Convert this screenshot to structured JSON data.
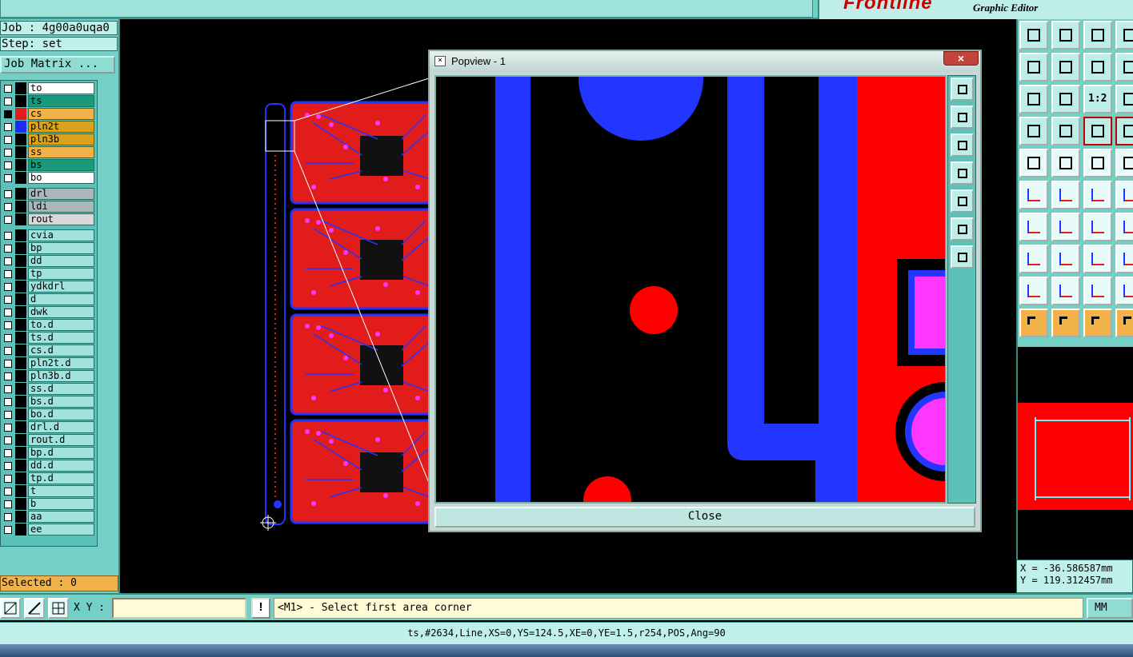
{
  "header": {
    "title_text": "",
    "brand": "Frontline",
    "brand_subtitle": "Graphic Editor"
  },
  "job": {
    "job_label": "Job : 4g00a0uqa0",
    "step_label": "Step: set",
    "matrix_button": "Job Matrix ..."
  },
  "layers": [
    {
      "name": "to",
      "color": "#ffffff",
      "swatch": "#000000",
      "checked": false
    },
    {
      "name": "ts",
      "color": "#1a9a7a",
      "swatch": "#000000",
      "checked": false
    },
    {
      "name": "cs",
      "color": "#f2b24a",
      "swatch": "#e21b1b",
      "checked": true
    },
    {
      "name": "pln2t",
      "color": "#d9a21a",
      "swatch": "#1d2bff",
      "checked": false
    },
    {
      "name": "pln3b",
      "color": "#d9a21a",
      "swatch": "#000000",
      "checked": false
    },
    {
      "name": "ss",
      "color": "#f2b24a",
      "swatch": "#000000",
      "checked": false
    },
    {
      "name": "bs",
      "color": "#1a9a7a",
      "swatch": "#000000",
      "checked": false
    },
    {
      "name": "bo",
      "color": "#ffffff",
      "swatch": "#000000",
      "checked": false
    },
    {
      "name": "drl",
      "color": "#a8b8b8",
      "swatch": "#000000",
      "checked": false
    },
    {
      "name": "ldi",
      "color": "#a8b8b8",
      "swatch": "#000000",
      "checked": false
    },
    {
      "name": "rout",
      "color": "#d8d8d8",
      "swatch": "#000000",
      "checked": false
    },
    {
      "name": "cvia",
      "color": "#9fe3dc",
      "swatch": "#000000",
      "checked": false
    },
    {
      "name": "bp",
      "color": "#9fe3dc",
      "swatch": "#000000",
      "checked": false
    },
    {
      "name": "dd",
      "color": "#9fe3dc",
      "swatch": "#000000",
      "checked": false
    },
    {
      "name": "tp",
      "color": "#9fe3dc",
      "swatch": "#000000",
      "checked": false
    },
    {
      "name": "ydkdrl",
      "color": "#9fe3dc",
      "swatch": "#000000",
      "checked": false
    },
    {
      "name": "d",
      "color": "#9fe3dc",
      "swatch": "#000000",
      "checked": false
    },
    {
      "name": "dwk",
      "color": "#9fe3dc",
      "swatch": "#000000",
      "checked": false
    },
    {
      "name": "to.d",
      "color": "#9fe3dc",
      "swatch": "#000000",
      "checked": false
    },
    {
      "name": "ts.d",
      "color": "#9fe3dc",
      "swatch": "#000000",
      "checked": false
    },
    {
      "name": "cs.d",
      "color": "#9fe3dc",
      "swatch": "#000000",
      "checked": false
    },
    {
      "name": "pln2t.d",
      "color": "#9fe3dc",
      "swatch": "#000000",
      "checked": false
    },
    {
      "name": "pln3b.d",
      "color": "#9fe3dc",
      "swatch": "#000000",
      "checked": false
    },
    {
      "name": "ss.d",
      "color": "#9fe3dc",
      "swatch": "#000000",
      "checked": false
    },
    {
      "name": "bs.d",
      "color": "#9fe3dc",
      "swatch": "#000000",
      "checked": false
    },
    {
      "name": "bo.d",
      "color": "#9fe3dc",
      "swatch": "#000000",
      "checked": false
    },
    {
      "name": "drl.d",
      "color": "#9fe3dc",
      "swatch": "#000000",
      "checked": false
    },
    {
      "name": "rout.d",
      "color": "#9fe3dc",
      "swatch": "#000000",
      "checked": false
    },
    {
      "name": "bp.d",
      "color": "#9fe3dc",
      "swatch": "#000000",
      "checked": false
    },
    {
      "name": "dd.d",
      "color": "#9fe3dc",
      "swatch": "#000000",
      "checked": false
    },
    {
      "name": "tp.d",
      "color": "#9fe3dc",
      "swatch": "#000000",
      "checked": false
    },
    {
      "name": "t",
      "color": "#9fe3dc",
      "swatch": "#000000",
      "checked": false
    },
    {
      "name": "b",
      "color": "#9fe3dc",
      "swatch": "#000000",
      "checked": false
    },
    {
      "name": "aa",
      "color": "#9fe3dc",
      "swatch": "#000000",
      "checked": false
    },
    {
      "name": "ee",
      "color": "#9fe3dc",
      "swatch": "#000000",
      "checked": false
    }
  ],
  "selected_label": "Selected : 0",
  "popview": {
    "title": "Popview - 1",
    "close_x": "×",
    "close_button": "Close",
    "tools": [
      "zoom-window-icon",
      "zoom-in-icon",
      "zoom-out-icon",
      "pan-left-icon",
      "pan-right-icon",
      "fit-icon",
      "zoom-home-icon"
    ]
  },
  "right_tools": {
    "rows": [
      [
        "zoom-up-icon",
        "zoom-down-icon",
        "home-icon",
        "window-icon"
      ],
      [
        "pan-left-icon",
        "pan-right-icon",
        "swap-icon",
        "redraw-icon"
      ],
      [
        "fit-screen-icon",
        "fit-profile-icon",
        "ratio-icon",
        "help-icon"
      ],
      [
        "tool-palette-icon",
        "measure-pad-icon",
        "net-icon",
        "net2-icon"
      ],
      [
        "snap-icon",
        "snap-line-icon",
        "ruler-icon",
        "grid-icon"
      ],
      [
        "connect-icon",
        "cross-icon",
        "point-icon",
        "point2-icon"
      ],
      [
        "draw-line-icon",
        "draw-line2-icon",
        "arc-icon",
        "bracket-icon"
      ],
      [
        "add-pad-icon",
        "line-icon",
        "resize-icon",
        "shape-icon"
      ],
      [
        "angle-icon",
        "angle2-icon",
        "angle3-icon",
        "angle4-icon"
      ],
      [
        "select-icon",
        "select-box-icon",
        "select-edit-icon",
        "select-step-icon"
      ]
    ],
    "ratio_label": "1:2"
  },
  "coords": {
    "x": "X = -36.586587mm",
    "y": "Y = 119.312457mm"
  },
  "cmdbar": {
    "xy_label": "X Y :",
    "xy_value": "",
    "excl": "!",
    "prompt": "<M1> - Select first area corner",
    "units": "MM"
  },
  "status": "ts,#2634,Line,XS=0,YS=124.5,XE=0,YE=1.5,r254,POS,Ang=90"
}
